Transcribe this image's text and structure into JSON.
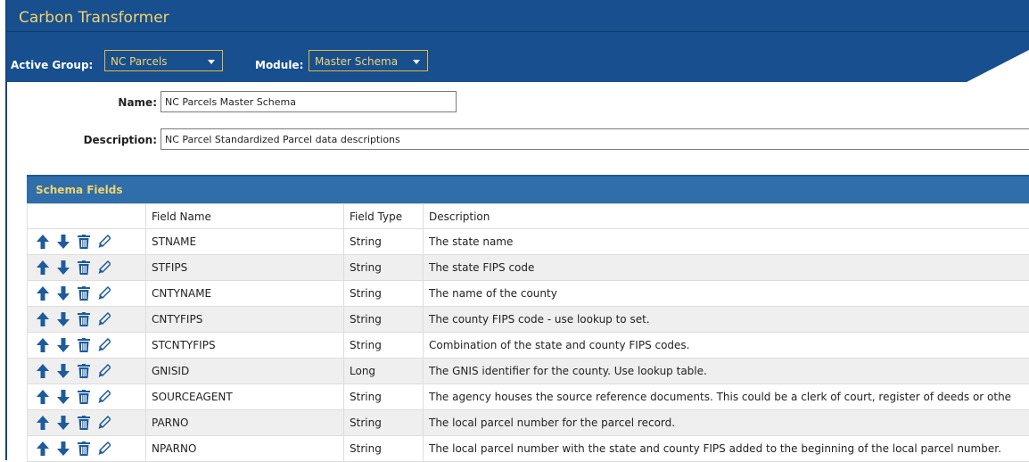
{
  "app": {
    "title": "Carbon Transformer"
  },
  "toolbar": {
    "active_group_label": "Active Group:",
    "active_group_value": "NC Parcels",
    "module_label": "Module:",
    "module_value": "Master Schema"
  },
  "form": {
    "name_label": "Name:",
    "name_value": "NC Parcels Master Schema",
    "description_label": "Description:",
    "description_value": "NC Parcel Standardized Parcel data descriptions"
  },
  "schema": {
    "title": "Schema Fields",
    "columns": {
      "field_name": "Field Name",
      "field_type": "Field Type",
      "description": "Description"
    },
    "row_icons": [
      "move-up-icon",
      "move-down-icon",
      "delete-icon",
      "edit-icon"
    ],
    "rows": [
      {
        "name": "STNAME",
        "type": "String",
        "description": "The state name"
      },
      {
        "name": "STFIPS",
        "type": "String",
        "description": "The state FIPS code"
      },
      {
        "name": "CNTYNAME",
        "type": "String",
        "description": "The name of the county"
      },
      {
        "name": "CNTYFIPS",
        "type": "String",
        "description": "The county FIPS code - use lookup to set."
      },
      {
        "name": "STCNTYFIPS",
        "type": "String",
        "description": "Combination of the state and county FIPS codes."
      },
      {
        "name": "GNISID",
        "type": "Long",
        "description": "The GNIS identifier for the county.  Use lookup table."
      },
      {
        "name": "SOURCEAGENT",
        "type": "String",
        "description": "The agency houses the source reference documents.  This could be a clerk of court, register of deeds or othe"
      },
      {
        "name": "PARNO",
        "type": "String",
        "description": "The local parcel number for the parcel record."
      },
      {
        "name": "NPARNO",
        "type": "String",
        "description": "The local parcel number with the state and county FIPS added to the beginning of the local parcel number."
      }
    ]
  },
  "colors": {
    "header_bg": "#174f8f",
    "accent_gold": "#f3d36c",
    "panel_header_bg": "#2f6eaa",
    "icon_blue": "#1d5b9c"
  }
}
